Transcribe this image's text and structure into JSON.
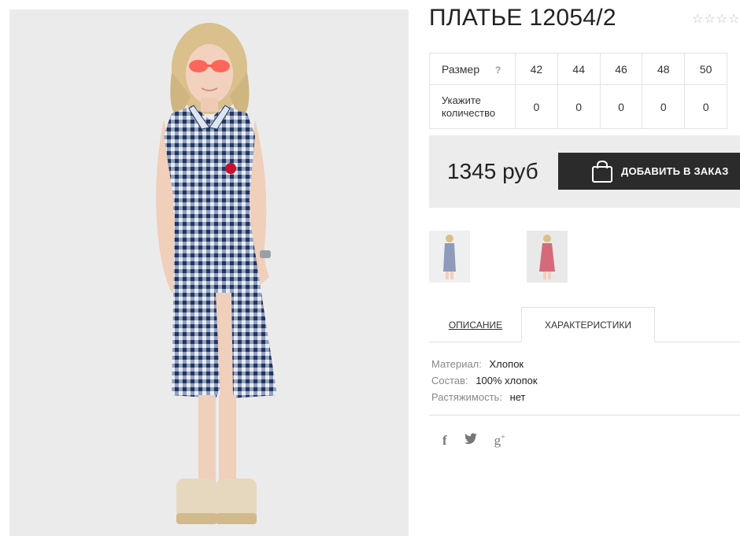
{
  "product": {
    "title": "ПЛАТЬЕ 12054/2",
    "rating_stars": "☆☆☆☆☆"
  },
  "sizes": {
    "size_label": "Размер",
    "help_mark": "?",
    "qty_label": "Укажите количество",
    "items": [
      {
        "size": "42",
        "qty": "0"
      },
      {
        "size": "44",
        "qty": "0"
      },
      {
        "size": "46",
        "qty": "0"
      },
      {
        "size": "48",
        "qty": "0"
      },
      {
        "size": "50",
        "qty": "0"
      }
    ]
  },
  "price": {
    "value": "1345 руб",
    "add_to_cart_label": "ДОБАВИТЬ В ЗАКАЗ"
  },
  "tabs": {
    "description": "ОПИСАНИЕ",
    "characteristics": "ХАРАКТЕРИСТИКИ"
  },
  "characteristics": [
    {
      "key": "Материал:",
      "value": "Хлопок"
    },
    {
      "key": "Состав:",
      "value": "100% хлопок"
    },
    {
      "key": "Растяжимость:",
      "value": "нет"
    }
  ],
  "social": {
    "facebook": "f",
    "twitter": "🐦",
    "googleplus": "g+"
  },
  "colors": {
    "button_bg": "#2b2b2b",
    "price_box_bg": "#ececec",
    "dress_navy": "#2c3e6b",
    "thumb2_dress": "#d66a7a"
  }
}
